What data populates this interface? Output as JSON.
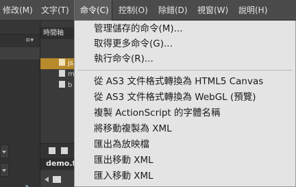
{
  "menubar": {
    "items": [
      {
        "label": "修改(M)"
      },
      {
        "label": "文字(T)"
      },
      {
        "label": "命令(C)"
      },
      {
        "label": "控制(O)"
      },
      {
        "label": "除錯(D)"
      },
      {
        "label": "視窗(W)"
      },
      {
        "label": "說明(H)"
      }
    ]
  },
  "left_panel": {
    "menu_icon": "≡▾"
  },
  "mid_panel": {
    "tab_label": "時間軸",
    "files": [
      {
        "label": "js"
      },
      {
        "label": "m"
      },
      {
        "label": "b"
      }
    ],
    "doc_tab": "demo.fla"
  },
  "command_menu": {
    "group1": [
      {
        "label": "管理儲存的命令(M)..."
      },
      {
        "label": "取得更多命令(G)..."
      },
      {
        "label": "執行命令(R)..."
      }
    ],
    "group2": [
      {
        "label": "從 AS3 文件格式轉換為 HTML5 Canvas"
      },
      {
        "label": "從 AS3 文件格式轉換為 WebGL (預覽)"
      },
      {
        "label": "複製 ActionScript 的字體名稱"
      },
      {
        "label": "將移動複製為 XML"
      },
      {
        "label": "匯出為放映檔"
      },
      {
        "label": "匯出移動 XML"
      },
      {
        "label": "匯入移動 XML"
      }
    ]
  },
  "colors": {
    "menubar_bg": "#4b4b4b",
    "menu_bg": "#e4e4e4",
    "selection": "#b88a2c"
  }
}
